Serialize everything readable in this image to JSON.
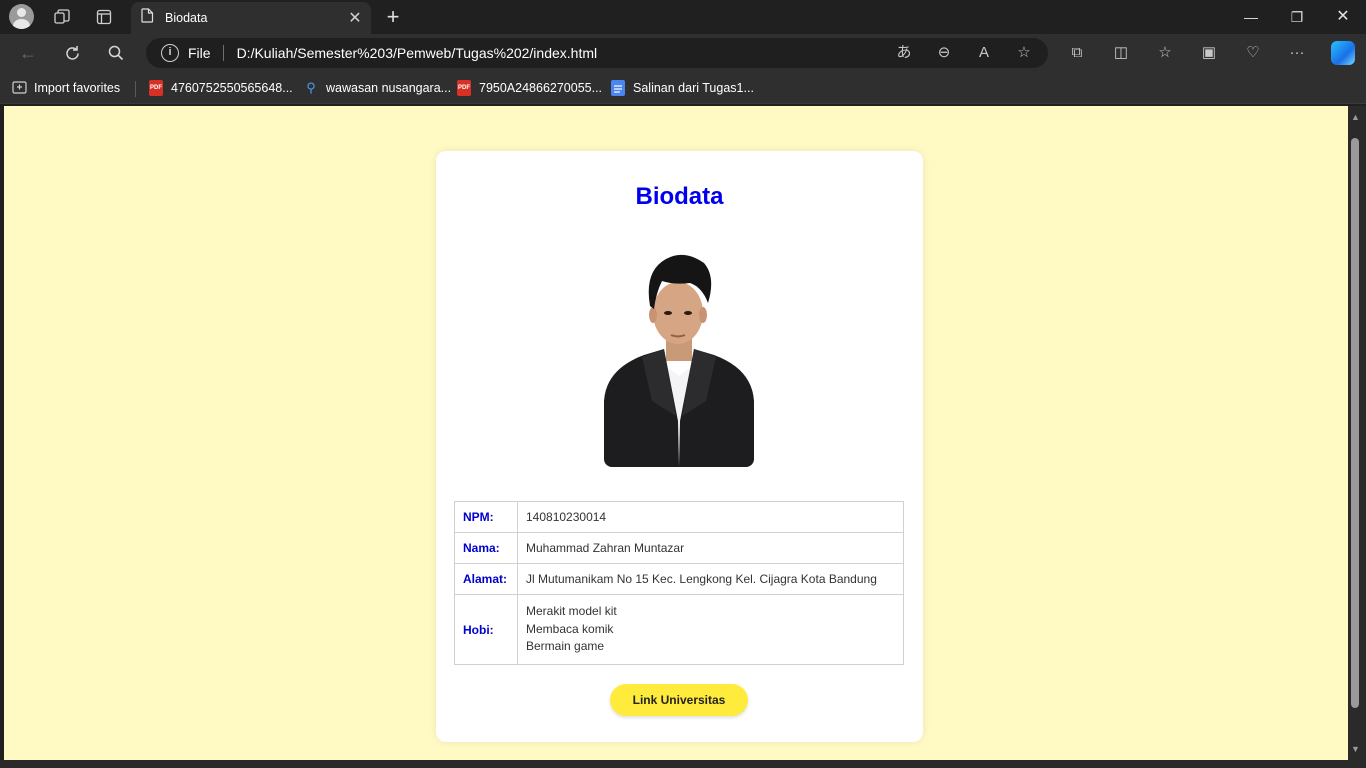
{
  "browser": {
    "tab_title": "Biodata",
    "address_scheme": "File",
    "address_url": "D:/Kuliah/Semester%203/Pemweb/Tugas%202/index.html"
  },
  "bookmarks": [
    {
      "label": "Import favorites",
      "icon": "import-favorites-icon"
    },
    {
      "label": "4760752550565648...",
      "icon": "pdf-icon"
    },
    {
      "label": "wawasan nusangara...",
      "icon": "search-icon"
    },
    {
      "label": "7950A24866270055...",
      "icon": "pdf-icon"
    },
    {
      "label": "Salinan dari Tugas1...",
      "icon": "google-docs-icon"
    }
  ],
  "page": {
    "title": "Biodata",
    "rows": [
      {
        "label": "NPM:",
        "value": "140810230014"
      },
      {
        "label": "Nama:",
        "value": "Muhammad Zahran Muntazar"
      },
      {
        "label": "Alamat:",
        "value": "Jl Mutumanikam No 15 Kec. Lengkong Kel. Cijagra Kota Bandung"
      },
      {
        "label": "Hobi:",
        "values": [
          "Merakit model kit",
          "Membaca komik",
          "Bermain game"
        ]
      }
    ],
    "link_label": "Link Universitas"
  },
  "colors": {
    "page_background": "#fff9c4",
    "title": "#0000ee",
    "label": "#0000cc",
    "button": "#ffeb3b"
  }
}
